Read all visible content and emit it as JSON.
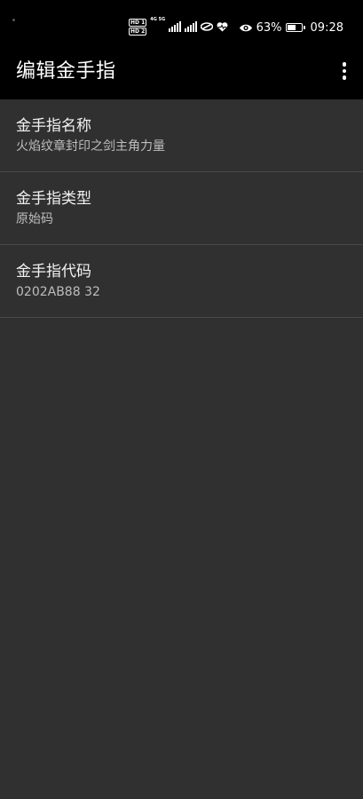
{
  "status_bar": {
    "battery": "63%",
    "time": "09:28",
    "battery_level": 0.63,
    "sim": [
      "HD 1",
      "HD 2"
    ],
    "network": "4G 5G"
  },
  "app_bar": {
    "title": "编辑金手指"
  },
  "fields": [
    {
      "label": "金手指名称",
      "value": "火焰纹章封印之剑主角力量"
    },
    {
      "label": "金手指类型",
      "value": "原始码"
    },
    {
      "label": "金手指代码",
      "value": "0202AB88 32"
    }
  ],
  "colors": {
    "background": "#303030",
    "bar": "#000000",
    "divider": "#4a4a4a"
  }
}
